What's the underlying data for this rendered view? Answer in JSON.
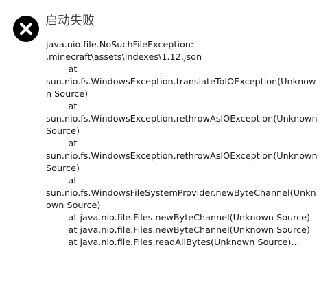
{
  "dialog": {
    "title": "启动失败",
    "icon": "error-x-icon",
    "message": "java.nio.file.NoSuchFileException:\n.minecraft\\assets\\indexes\\1.12.json\n\tat\nsun.nio.fs.WindowsException.translateToIOException(Unknown Source)\n\tat\nsun.nio.fs.WindowsException.rethrowAsIOException(Unknown Source)\n\tat\nsun.nio.fs.WindowsException.rethrowAsIOException(Unknown Source)\n\tat\nsun.nio.fs.WindowsFileSystemProvider.newByteChannel(Unknown Source)\n\tat java.nio.file.Files.newByteChannel(Unknown Source)\n\tat java.nio.file.Files.newByteChannel(Unknown Source)\n\tat java.nio.file.Files.readAllBytes(Unknown Source)..."
  },
  "colors": {
    "icon_background": "#000000",
    "icon_glyph": "#ffffff",
    "title_text": "#444444",
    "body_text": "#1a1a1a"
  }
}
